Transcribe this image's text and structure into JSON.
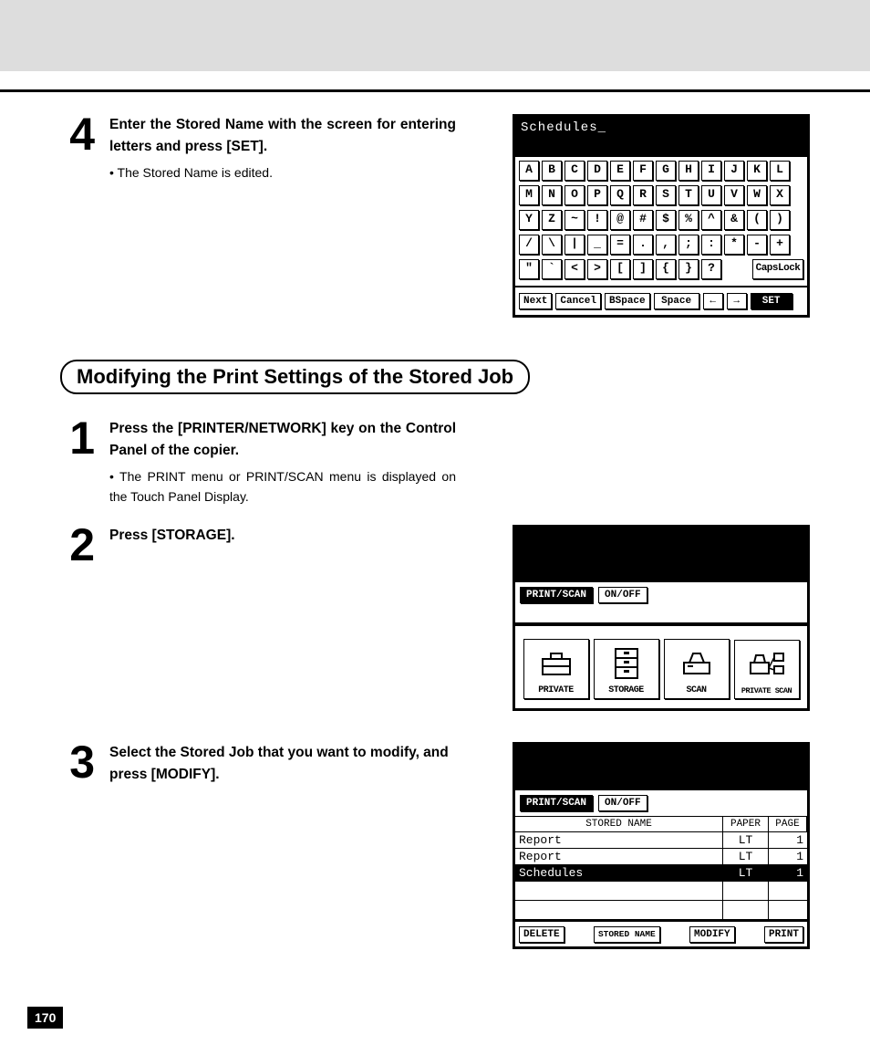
{
  "page_number": "170",
  "step4": {
    "num": "4",
    "title": "Enter the Stored Name with the screen for entering letters and press [SET].",
    "bullet": "The Stored Name is edited."
  },
  "section_title": "Modifying the Print Settings of the Stored Job",
  "step1": {
    "num": "1",
    "title": "Press the [PRINTER/NETWORK] key on the Control Panel of the copier.",
    "bullet": "The PRINT menu or PRINT/SCAN menu is displayed on the Touch Panel Display."
  },
  "step2": {
    "num": "2",
    "title": "Press [STORAGE]."
  },
  "step3": {
    "num": "3",
    "title": "Select the Stored Job that you want to modify, and press [MODIFY]."
  },
  "keyboard": {
    "title": "Schedules",
    "rows": [
      [
        "A",
        "B",
        "C",
        "D",
        "E",
        "F",
        "G",
        "H",
        "I",
        "J",
        "K",
        "L"
      ],
      [
        "M",
        "N",
        "O",
        "P",
        "Q",
        "R",
        "S",
        "T",
        "U",
        "V",
        "W",
        "X"
      ],
      [
        "Y",
        "Z",
        "~",
        "!",
        "@",
        "#",
        "$",
        "%",
        "^",
        "&",
        "(",
        ")"
      ],
      [
        "/",
        "\\",
        "|",
        "_",
        "=",
        ".",
        ",",
        ";",
        ":",
        "*",
        "-",
        "+"
      ],
      [
        "\"",
        "`",
        "<",
        ">",
        "[",
        "]",
        "{",
        "}",
        "?"
      ]
    ],
    "capslock": "CapsLock",
    "foot": {
      "next": "Next",
      "cancel": "Cancel",
      "bspace": "BSpace",
      "space": "Space",
      "left": "←",
      "right": "→",
      "set": "SET"
    }
  },
  "iconscreen": {
    "tab1": "PRINT/SCAN",
    "tab2": "ON/OFF",
    "icons": [
      "PRIVATE",
      "STORAGE",
      "SCAN",
      "PRIVATE SCAN"
    ]
  },
  "tablescreen": {
    "tab1": "PRINT/SCAN",
    "tab2": "ON/OFF",
    "headers": {
      "c1": "STORED NAME",
      "c2": "PAPER",
      "c3": "PAGE"
    },
    "rows": [
      {
        "name": "Report",
        "paper": "LT",
        "page": "1",
        "sel": false
      },
      {
        "name": "Report",
        "paper": "LT",
        "page": "1",
        "sel": false
      },
      {
        "name": "Schedules",
        "paper": "LT",
        "page": "1",
        "sel": true
      }
    ],
    "foot": [
      "DELETE",
      "STORED NAME",
      "MODIFY",
      "PRINT"
    ]
  }
}
